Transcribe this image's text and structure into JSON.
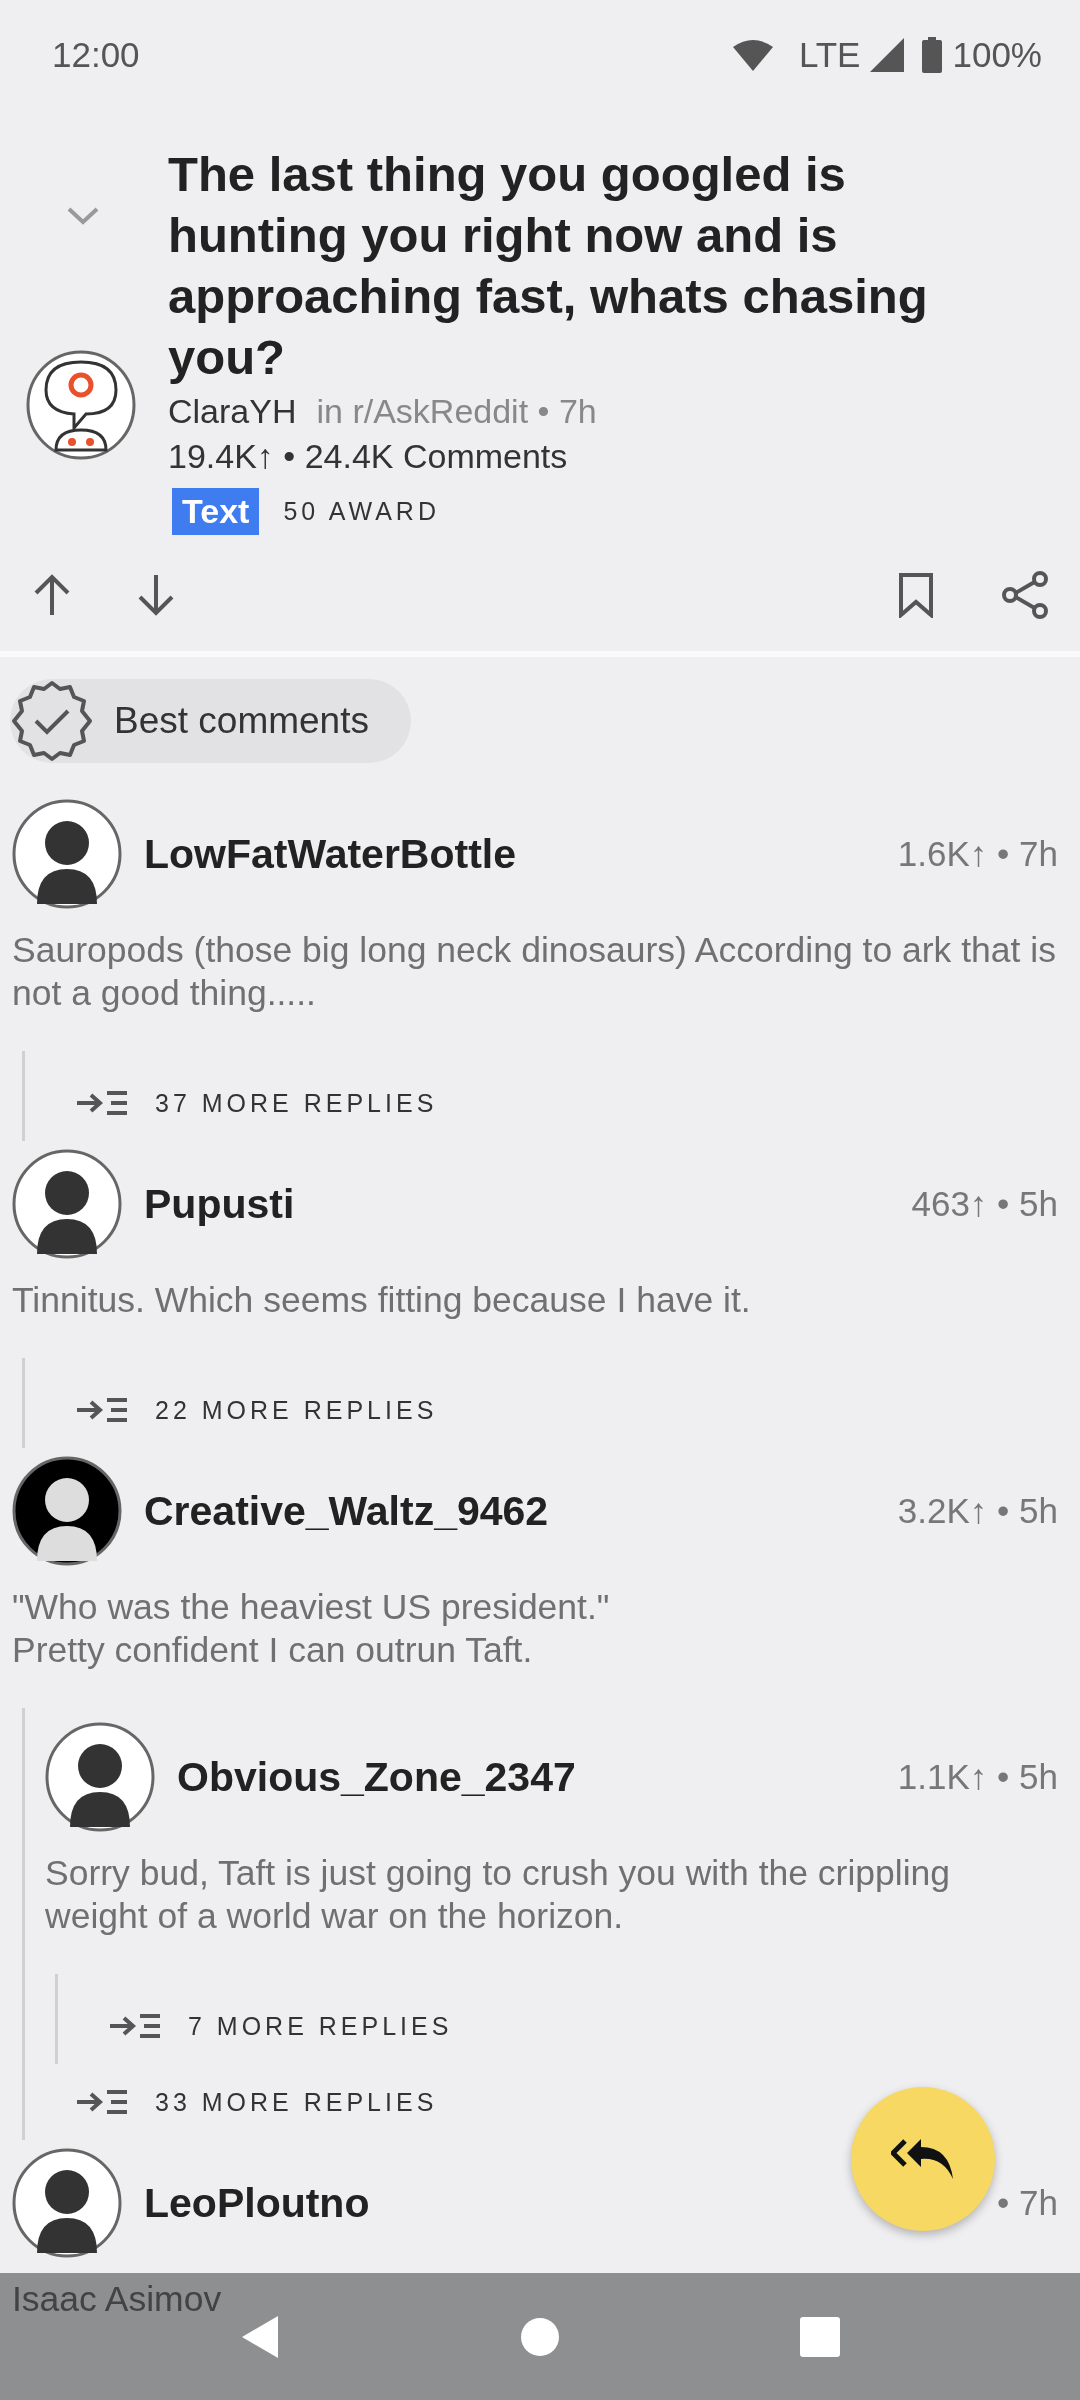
{
  "status_bar": {
    "time": "12:00",
    "network": "LTE",
    "battery": "100%"
  },
  "post": {
    "title": "The last thing you googled is hunting you right now and is approaching fast, whats chasing you?",
    "author": "ClaraYH",
    "subreddit": "in r/AskReddit • 7h",
    "stats": "19.4K↑ • 24.4K Comments",
    "flair": "Text",
    "awards": "50 AWARD"
  },
  "sort": {
    "label": "Best comments"
  },
  "comments": [
    {
      "author": "LowFatWaterBottle",
      "meta": "1.6K↑ • 7h",
      "body": "Sauropods (those big long neck dinosaurs) According to ark that is not a good thing.....",
      "more_replies": "37 MORE REPLIES"
    },
    {
      "author": "Pupusti",
      "meta": "463↑ • 5h",
      "body": "Tinnitus. Which seems fitting because I have it.",
      "more_replies": "22 MORE REPLIES"
    },
    {
      "author": "Creative_Waltz_9462",
      "meta": "3.2K↑ • 5h",
      "body": "\"Who was the heaviest US president.\"\nPretty confident I can outrun Taft.",
      "more_replies": "33 MORE REPLIES",
      "children": [
        {
          "author": "Obvious_Zone_2347",
          "meta": "1.1K↑ • 5h",
          "body": "Sorry bud, Taft is just going to crush you with the crippling weight of a world war on the horizon.",
          "more_replies": "7 MORE REPLIES"
        }
      ]
    },
    {
      "author": "LeoPloutno",
      "meta": "• 7h",
      "body": "Isaac Asimov"
    }
  ]
}
